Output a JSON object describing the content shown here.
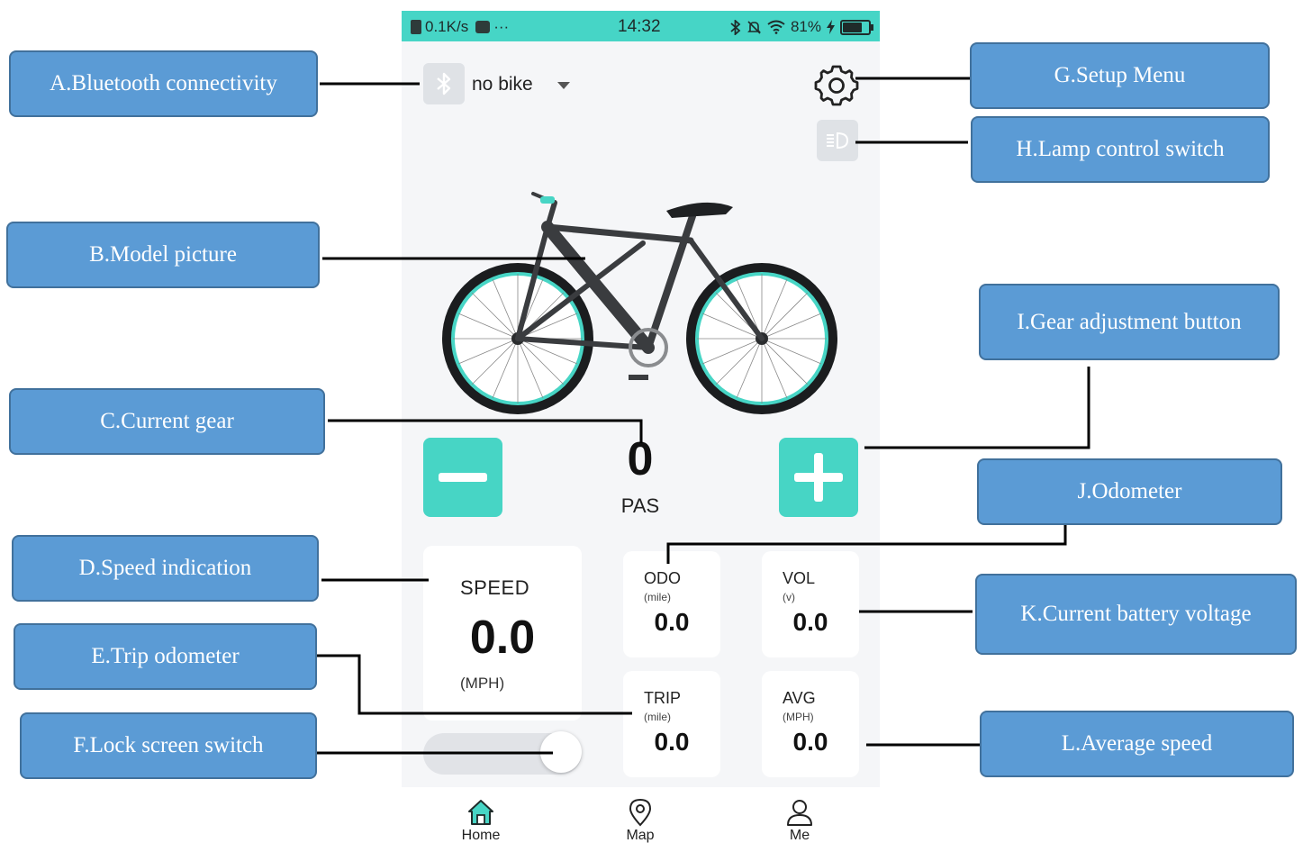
{
  "status_bar": {
    "network_speed": "0.1K/s",
    "more_indicator": "···",
    "time": "14:32",
    "battery_percent": "81%",
    "battery_level": 0.81,
    "icons": [
      "sim-icon",
      "message-icon",
      "bluetooth-icon",
      "mute-icon",
      "wifi-icon",
      "charging-icon",
      "battery-icon"
    ]
  },
  "header": {
    "bluetooth_icon": "bluetooth-icon",
    "bike_selector_value": "no bike",
    "settings_icon": "gear-icon",
    "lamp_icon": "headlight-icon"
  },
  "gear": {
    "value": "0",
    "label": "PAS",
    "minus_icon": "minus-icon",
    "plus_icon": "plus-icon"
  },
  "speed": {
    "title": "SPEED",
    "value": "0.0",
    "unit": "(MPH)"
  },
  "stats": {
    "odo": {
      "title": "ODO",
      "unit": "(mile)",
      "value": "0.0"
    },
    "vol": {
      "title": "VOL",
      "unit": "(v)",
      "value": "0.0"
    },
    "trip": {
      "title": "TRIP",
      "unit": "(mile)",
      "value": "0.0"
    },
    "avg": {
      "title": "AVG",
      "unit": "(MPH)",
      "value": "0.0"
    }
  },
  "lock_switch": {
    "state": "on"
  },
  "tabs": [
    {
      "label": "Home",
      "icon": "home-icon",
      "active": true
    },
    {
      "label": "Map",
      "icon": "map-pin-icon",
      "active": false
    },
    {
      "label": "Me",
      "icon": "user-icon",
      "active": false
    }
  ],
  "callouts": {
    "a": "A.Bluetooth connectivity",
    "b": "B.Model picture",
    "c": "C.Current gear",
    "d": "D.Speed indication",
    "e": "E.Trip odometer",
    "f": "F.Lock screen switch",
    "g": "G.Setup Menu",
    "h": "H.Lamp control switch",
    "i": "I.Gear adjustment button",
    "j": "J.Odometer",
    "k": "K.Current battery voltage",
    "l": "L.Average speed"
  },
  "colors": {
    "accent": "#47d5c5",
    "status_bar": "#46d5c6",
    "callout_fill": "#5b9bd5",
    "callout_border": "#41719c",
    "background": "#f5f6f8"
  }
}
